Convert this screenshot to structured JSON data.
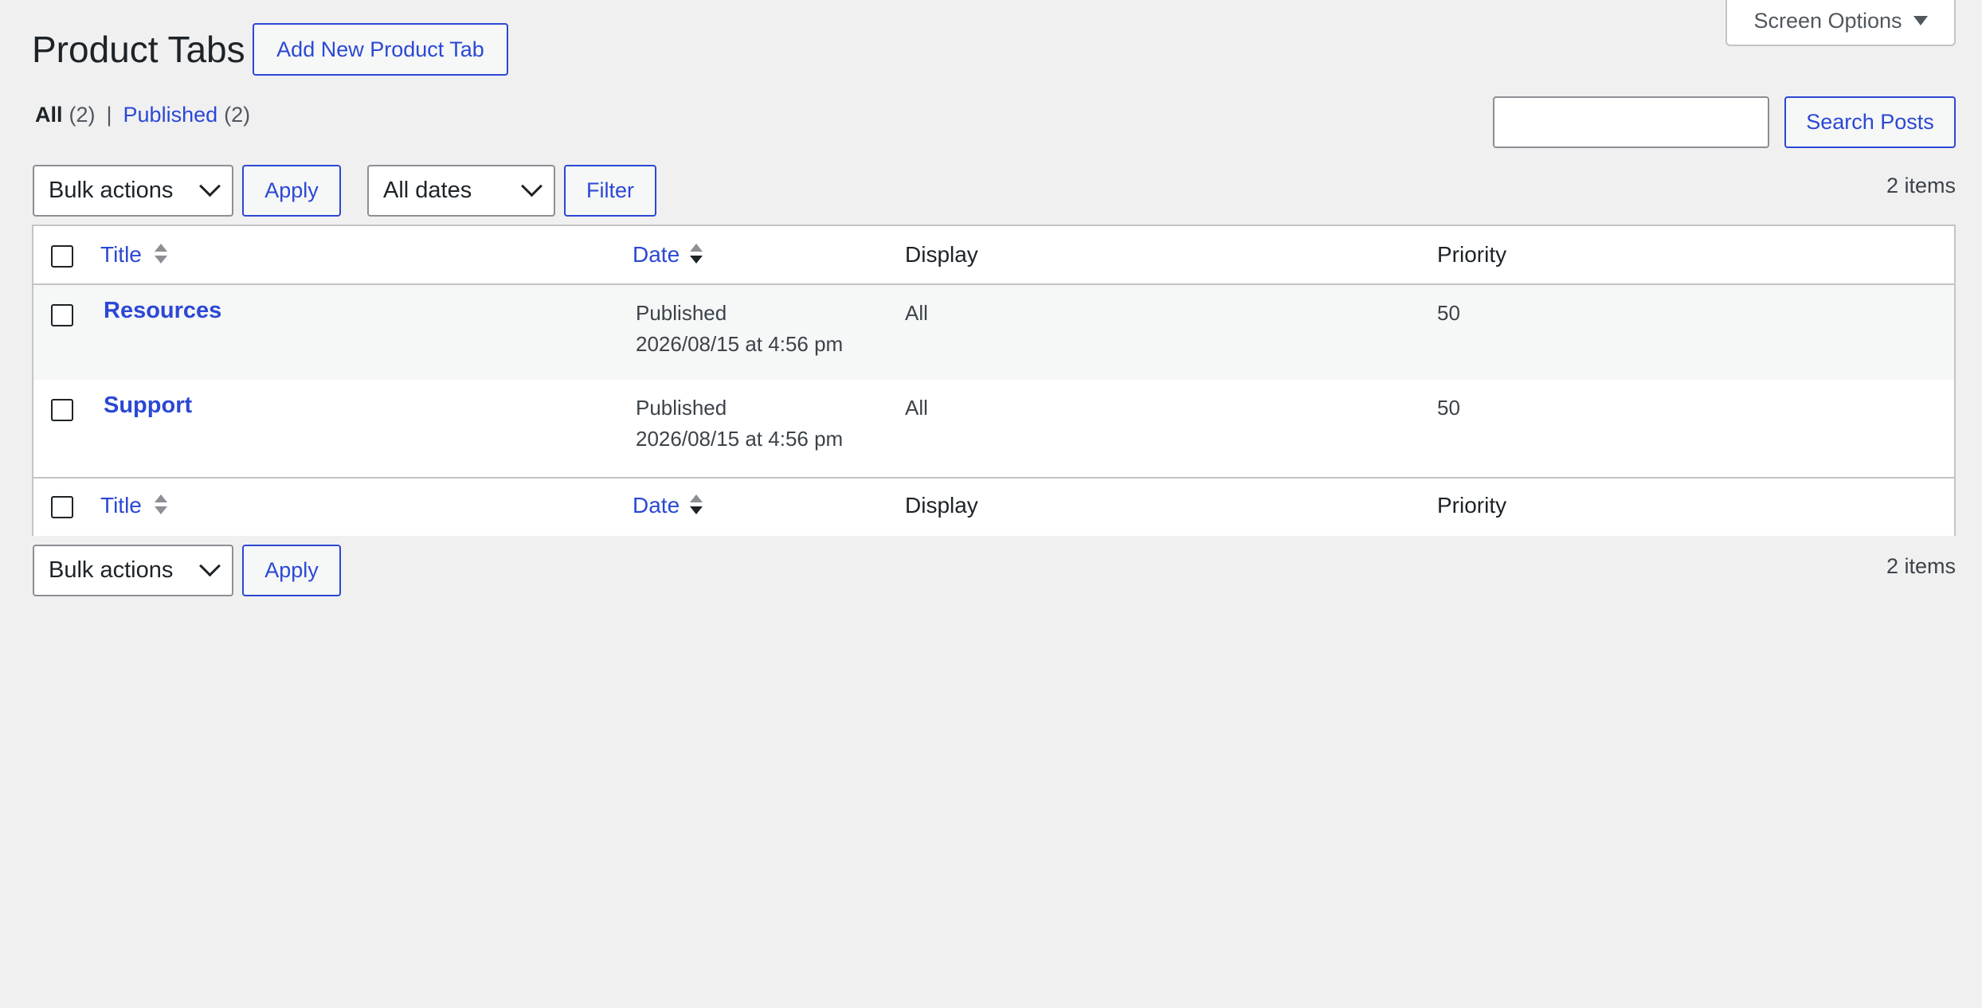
{
  "header": {
    "title": "Product Tabs",
    "add_new_label": "Add New Product Tab",
    "screen_options_label": "Screen Options"
  },
  "views": [
    {
      "label": "All",
      "count": "(2)"
    },
    {
      "label": "Published",
      "count": "(2)"
    }
  ],
  "views_separator": "|",
  "search": {
    "value": "",
    "button_label": "Search Posts"
  },
  "tablenav_top": {
    "bulk_actions": "Bulk actions",
    "apply_label": "Apply",
    "dates_filter": "All dates",
    "filter_label": "Filter",
    "items_count": "2 items"
  },
  "tablenav_bottom": {
    "bulk_actions": "Bulk actions",
    "apply_label": "Apply",
    "items_count": "2 items"
  },
  "columns": [
    "Title",
    "Date",
    "Display",
    "Priority"
  ],
  "rows": [
    {
      "title": "Resources",
      "status": "Published",
      "date": "2026/08/15 at 4:56 pm",
      "display": "All",
      "priority": "50"
    },
    {
      "title": "Support",
      "status": "Published",
      "date": "2026/08/15 at 4:56 pm",
      "display": "All",
      "priority": "50"
    }
  ]
}
